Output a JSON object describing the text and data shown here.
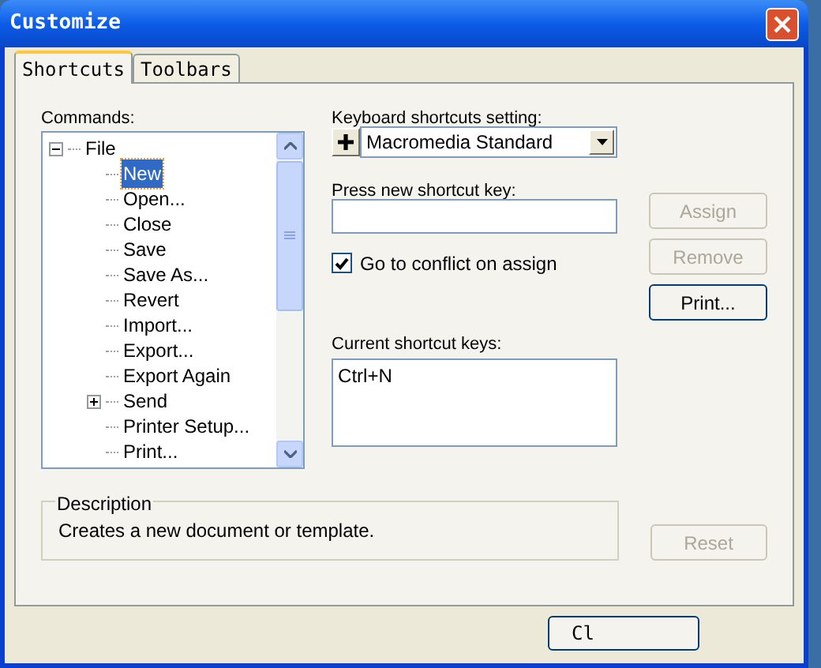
{
  "window": {
    "title": "Customize"
  },
  "tabs": [
    {
      "label": "Shortcuts",
      "selected": true
    },
    {
      "label": "Toolbars",
      "selected": false
    }
  ],
  "commands": {
    "label": "Commands:",
    "tree": [
      {
        "label": "File",
        "kind": "folder",
        "expanded": true,
        "selected": false,
        "children": [
          {
            "label": "New",
            "kind": "leaf",
            "selected": true
          },
          {
            "label": "Open...",
            "kind": "leaf",
            "selected": false
          },
          {
            "label": "Close",
            "kind": "leaf",
            "selected": false
          },
          {
            "label": "Save",
            "kind": "leaf",
            "selected": false
          },
          {
            "label": "Save As...",
            "kind": "leaf",
            "selected": false
          },
          {
            "label": "Revert",
            "kind": "leaf",
            "selected": false
          },
          {
            "label": "Import...",
            "kind": "leaf",
            "selected": false
          },
          {
            "label": "Export...",
            "kind": "leaf",
            "selected": false
          },
          {
            "label": "Export Again",
            "kind": "leaf",
            "selected": false
          },
          {
            "label": "Send",
            "kind": "folder",
            "expanded": false,
            "selected": false
          },
          {
            "label": "Printer Setup...",
            "kind": "leaf",
            "selected": false
          },
          {
            "label": "Print...",
            "kind": "leaf",
            "selected": false
          }
        ]
      }
    ]
  },
  "shortcut_setting": {
    "label": "Keyboard shortcuts setting:",
    "value": "Macromedia Standard"
  },
  "new_shortcut": {
    "label": "Press new shortcut key:"
  },
  "go_to_conflict": {
    "label": "Go to conflict on assign",
    "checked": true
  },
  "buttons": [
    {
      "label": "Assign",
      "disabled": true
    },
    {
      "label": "Remove",
      "disabled": true
    },
    {
      "label": "Print...",
      "disabled": false
    }
  ],
  "current_keys": {
    "label": "Current shortcut keys:",
    "items": [
      "Ctrl+N"
    ]
  },
  "description": {
    "label": "Description",
    "text": "Creates a new document or template."
  },
  "reset_button": {
    "label": "Reset",
    "disabled": true
  },
  "close_button": {
    "label": "Cl"
  }
}
